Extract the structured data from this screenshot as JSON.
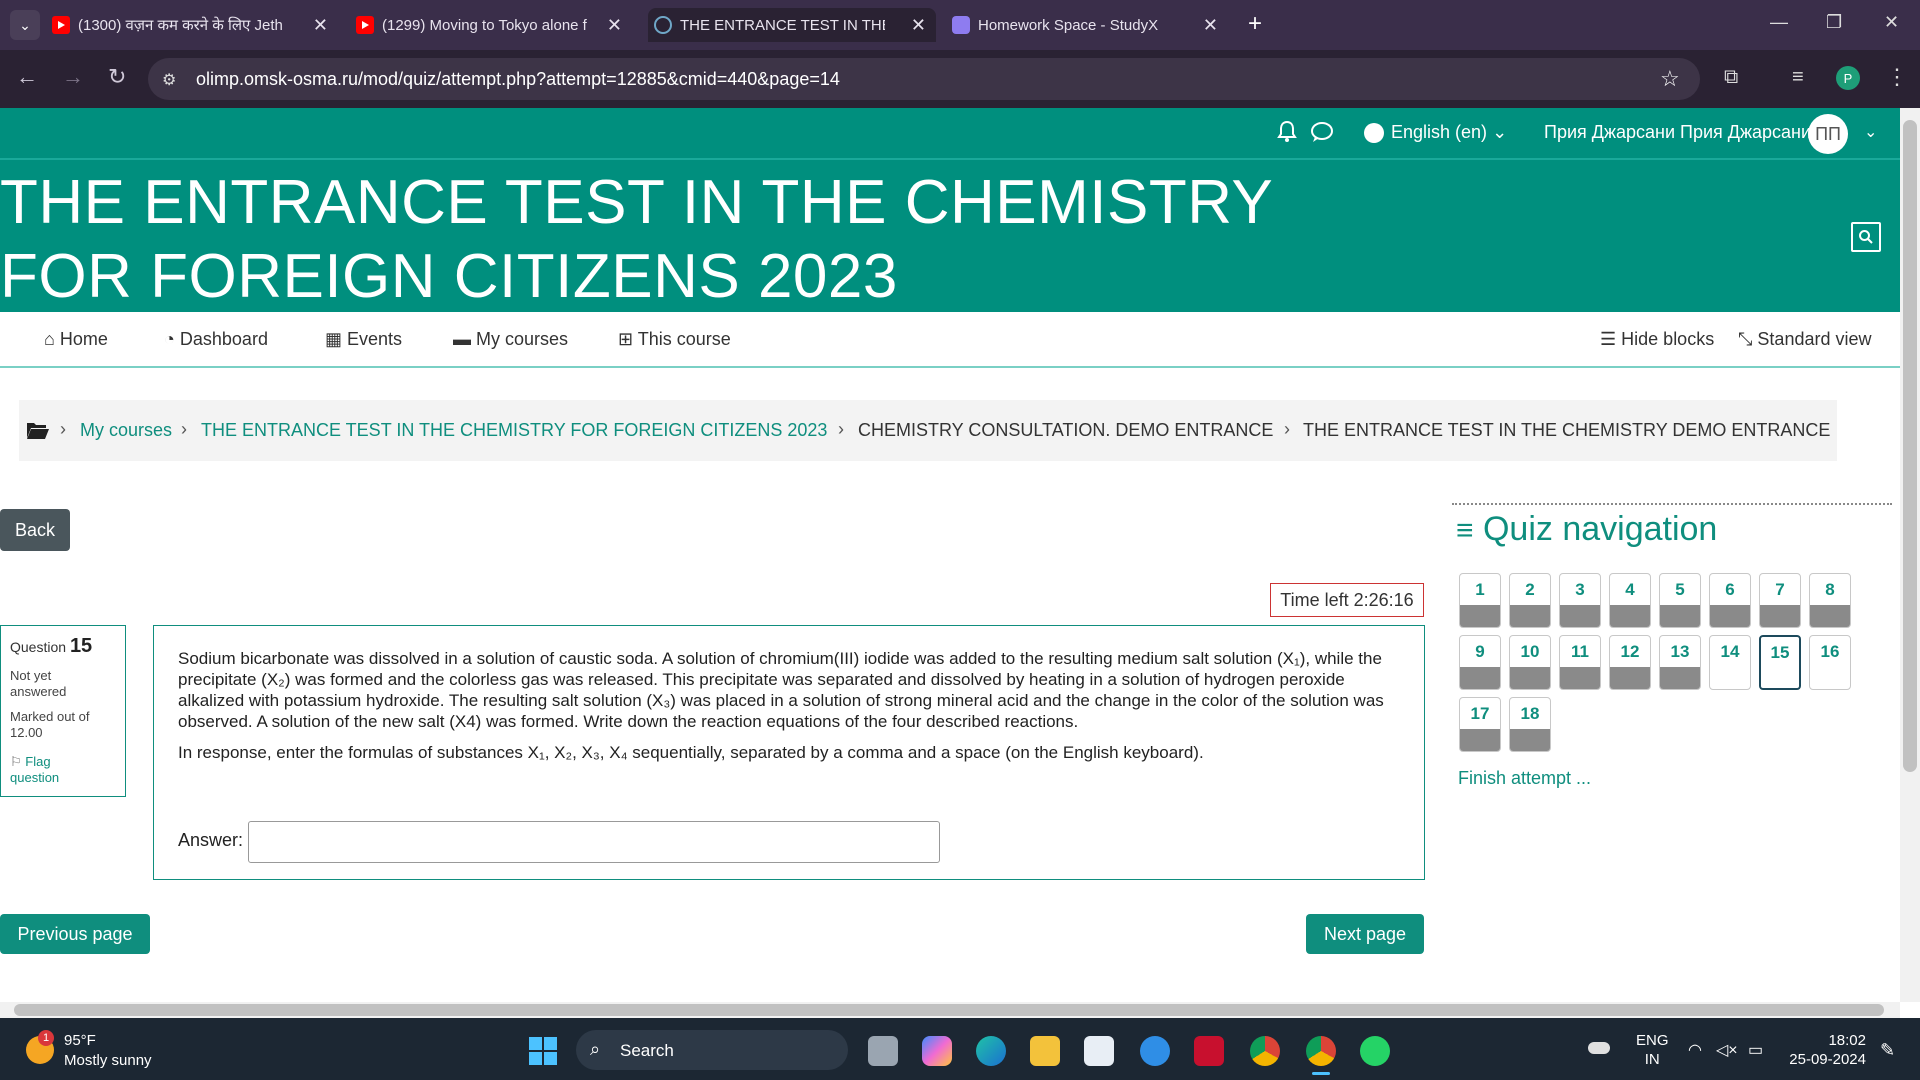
{
  "browser": {
    "tabs": [
      {
        "title": "(1300) वज़न कम करने के लिए Jeth",
        "active": false
      },
      {
        "title": "(1299) Moving to Tokyo alone f",
        "active": false
      },
      {
        "title": "THE ENTRANCE TEST IN THE CH",
        "active": true
      },
      {
        "title": "Homework Space - StudyX",
        "active": false
      }
    ],
    "new_tab": "+",
    "url": "olimp.omsk-osma.ru/mod/quiz/attempt.php?attempt=12885&cmid=440&page=14",
    "profile_initial": "P"
  },
  "header": {
    "language": "English (en)",
    "user_name": "Прия Джарсани Прия Джарсани",
    "avatar_initials": "ПП",
    "site_title_line1": "THE ENTRANCE TEST IN THE CHEMISTRY",
    "site_title_line2": "FOR FOREIGN CITIZENS 2023"
  },
  "nav": {
    "home": "Home",
    "dashboard": "Dashboard",
    "events": "Events",
    "my_courses": "My courses",
    "this_course": "This course",
    "hide_blocks": "Hide blocks",
    "standard_view": "Standard view"
  },
  "breadcrumb": [
    {
      "label": "My courses",
      "link": true
    },
    {
      "label": "THE ENTRANCE TEST IN THE CHEMISTRY FOR FOREIGN CITIZENS 2023",
      "link": true
    },
    {
      "label": "CHEMISTRY CONSULTATION. DEMO ENTRANCE",
      "link": false
    },
    {
      "label": "THE ENTRANCE TEST IN THE CHEMISTRY DEMO ENTRANCE",
      "link": false
    }
  ],
  "quiz": {
    "back_label": "Back",
    "time_left": "Time left 2:26:16",
    "question_label": "Question",
    "question_number": "15",
    "status": "Not yet answered",
    "marked_out_of": "Marked out of 12.00",
    "flag_label": "Flag question",
    "question_p1": "Sodium bicarbonate was dissolved in a solution of caustic soda. A solution of chromium(III) iodide was added to the resulting medium salt solution (X₁), while the precipitate (X₂) was formed and the colorless gas was released. This precipitate was separated and dissolved by heating in a solution of hydrogen peroxide alkalized with potassium hydroxide. The resulting salt solution (X₃) was placed in a solution of strong mineral acid and the change in the color of the solution was observed. A solution of the new salt (X4) was formed. Write down the reaction equations of the four described reactions.",
    "question_p2": "In response, enter the formulas of substances X₁, X₂, X₃, X₄ sequentially, separated by a comma and a space (on the English keyboard).",
    "answer_label": "Answer:",
    "answer_value": "",
    "previous_label": "Previous page",
    "next_label": "Next page"
  },
  "quiz_navigation": {
    "title": "Quiz navigation",
    "buttons": [
      {
        "n": "1",
        "state": "answered"
      },
      {
        "n": "2",
        "state": "answered"
      },
      {
        "n": "3",
        "state": "answered"
      },
      {
        "n": "4",
        "state": "answered"
      },
      {
        "n": "5",
        "state": "answered"
      },
      {
        "n": "6",
        "state": "answered"
      },
      {
        "n": "7",
        "state": "answered"
      },
      {
        "n": "8",
        "state": "answered"
      },
      {
        "n": "9",
        "state": "answered"
      },
      {
        "n": "10",
        "state": "answered"
      },
      {
        "n": "11",
        "state": "answered"
      },
      {
        "n": "12",
        "state": "answered"
      },
      {
        "n": "13",
        "state": "answered"
      },
      {
        "n": "14",
        "state": "empty"
      },
      {
        "n": "15",
        "state": "current"
      },
      {
        "n": "16",
        "state": "empty"
      },
      {
        "n": "17",
        "state": "answered"
      },
      {
        "n": "18",
        "state": "answered"
      }
    ],
    "finish_label": "Finish attempt ..."
  },
  "taskbar": {
    "weather_temp": "95°F",
    "weather_desc": "Mostly sunny",
    "weather_badge": "1",
    "search_label": "Search",
    "lang_line1": "ENG",
    "lang_line2": "IN",
    "time": "18:02",
    "date": "25-09-2024"
  },
  "colors": {
    "brand_green": "#008f7e",
    "link_green": "#0f8e7e",
    "timer_border": "#cc3333"
  }
}
